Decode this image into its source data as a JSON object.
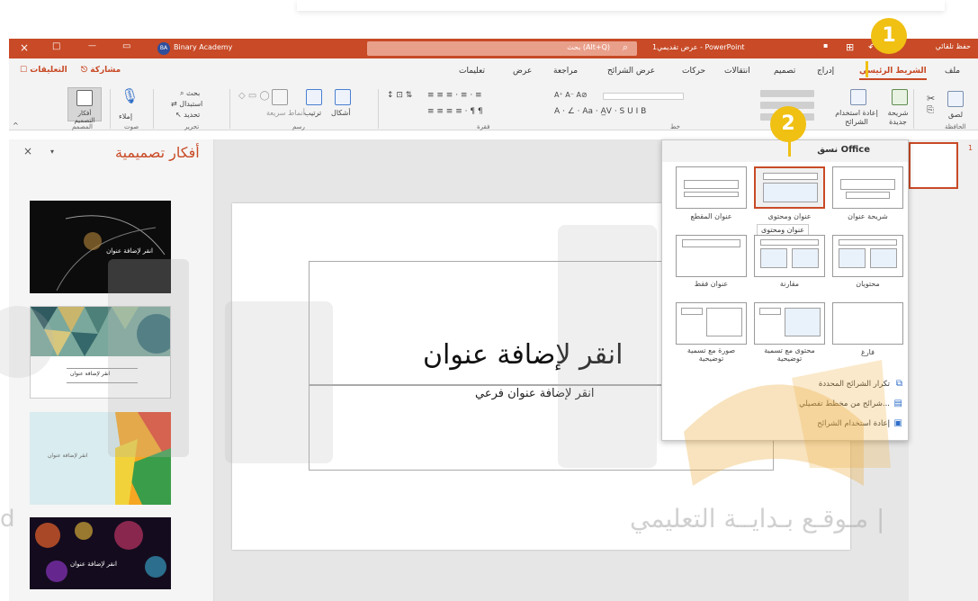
{
  "titlebar": {
    "close": "×",
    "restore": "□",
    "minimize": "—",
    "account_initials": "BA",
    "account_name": "Binary Academy",
    "search_text": "بحث (Alt+Q)",
    "doc_title": "عرض تقديمي1 - PowerPoint",
    "autosave": "حفظ تلقائي",
    "colors": {
      "bar": "#c84a26"
    }
  },
  "tabs": [
    {
      "label": "ملف"
    },
    {
      "label": "الشريط الرئيسي",
      "active": true
    },
    {
      "label": "إدراج"
    },
    {
      "label": "تصميم"
    },
    {
      "label": "انتقالات"
    },
    {
      "label": "حركات"
    },
    {
      "label": "عرض الشرائح"
    },
    {
      "label": "مراجعة"
    },
    {
      "label": "عرض"
    },
    {
      "label": "تعليمات"
    }
  ],
  "share": {
    "share_label": "مشاركة",
    "comments_label": "التعليقات"
  },
  "ribbon": {
    "paste": "لصق",
    "clipboard_group": "الحافظة",
    "new_slide": "شريحة جديدة",
    "reuse_slides": "إعادة استخدام الشرائح",
    "shapes": "أشكال",
    "arrange": "ترتيب",
    "quick_styles": "أنماط سريعة",
    "drawing_group": "رسم",
    "find": "بحث",
    "replace": "استبدال",
    "select": "تحديد",
    "editing_group": "تحرير",
    "dictate": "إملاء",
    "voice_group": "صوت",
    "designer": "أفكار التصميم",
    "designer_group": "المصمم",
    "paragraph_group": "فقرة",
    "font_group": "خط"
  },
  "layout_panel": {
    "header": "نسق Office",
    "layouts": [
      {
        "label": "شريحة عنوان"
      },
      {
        "label": "عنوان ومحتوى"
      },
      {
        "label": "عنوان المقطع"
      },
      {
        "label": "محتويان"
      },
      {
        "label": "مقارنة"
      },
      {
        "label": "عنوان فقط"
      },
      {
        "label": "فارغ"
      },
      {
        "label": "محتوى مع تسمية توضيحية"
      },
      {
        "label": "صورة مع تسمية توضيحية"
      }
    ],
    "tooltip": "عنوان ومحتوى",
    "menu": [
      {
        "label": "تكرار الشرائح المحددة"
      },
      {
        "label": "شرائح من مخطط تفصيلي..."
      },
      {
        "label": "إعادة استخدام الشرائح"
      }
    ]
  },
  "designer_pane": {
    "title": "أفكار تصميمية",
    "close": "×",
    "dropdown": "▾",
    "thumbs": [
      {
        "text": "انقر لإضافة عنوان"
      },
      {
        "text": "انقر لإضافة عنوان"
      },
      {
        "text": "انقر لإضافة عنوان"
      },
      {
        "text": "انقر لإضافة عنوان"
      }
    ]
  },
  "slide": {
    "title": "انقر لإضافة عنوان",
    "subtitle": "انقر لإضافة عنوان فرعي"
  },
  "slide_number": "1",
  "callouts": {
    "one": "1",
    "two": "2",
    "color": "#f0c013"
  },
  "watermark": {
    "tagline": "مـوقـع بـدايــة التعليمي |",
    "site": "d"
  }
}
